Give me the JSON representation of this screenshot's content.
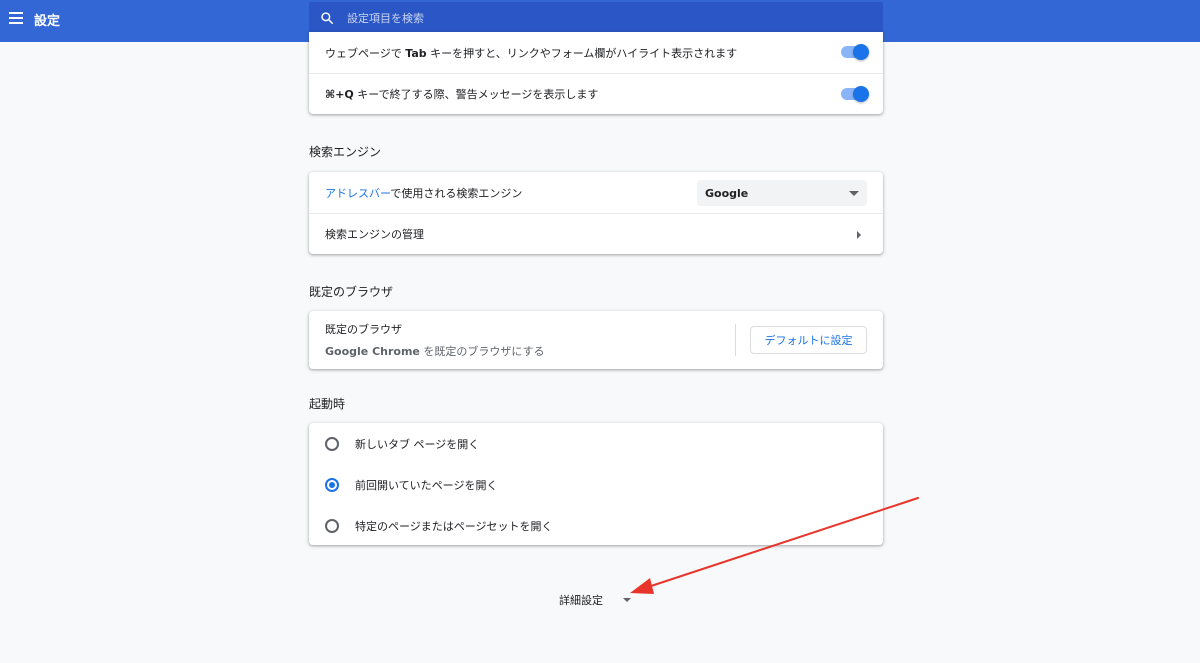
{
  "header": {
    "title": "設定",
    "search_placeholder": "設定項目を検索",
    "bg_color": "#3367d6"
  },
  "appearance": {
    "rows": [
      {
        "label_pre": "ウェブページで ",
        "label_bold": "Tab",
        "label_post": " キーを押すと、リンクやフォーム欄がハイライト表示されます",
        "toggle_on": true
      },
      {
        "label_bold": "⌘+Q",
        "label_post": " キーで終了する際、警告メッセージを表示します",
        "toggle_on": true
      }
    ]
  },
  "search_engine": {
    "section_title": "検索エンジン",
    "address_bar_link": "アドレスバー",
    "address_bar_rest": "で使用される検索エンジン",
    "selected_engine": "Google",
    "manage_label": "検索エンジンの管理"
  },
  "default_browser": {
    "section_title": "既定のブラウザ",
    "row_title": "既定のブラウザ",
    "sub_bold": "Google Chrome",
    "sub_rest": " を既定のブラウザにする",
    "button_label": "デフォルトに設定"
  },
  "startup": {
    "section_title": "起動時",
    "options": [
      {
        "label": "新しいタブ ページを開く",
        "checked": false
      },
      {
        "label": "前回開いていたページを開く",
        "checked": true
      },
      {
        "label": "特定のページまたはページセットを開く",
        "checked": false
      }
    ]
  },
  "advanced": {
    "label": "詳細設定"
  },
  "colors": {
    "accent": "#1a73e8",
    "annotation_arrow": "#e8352c"
  }
}
